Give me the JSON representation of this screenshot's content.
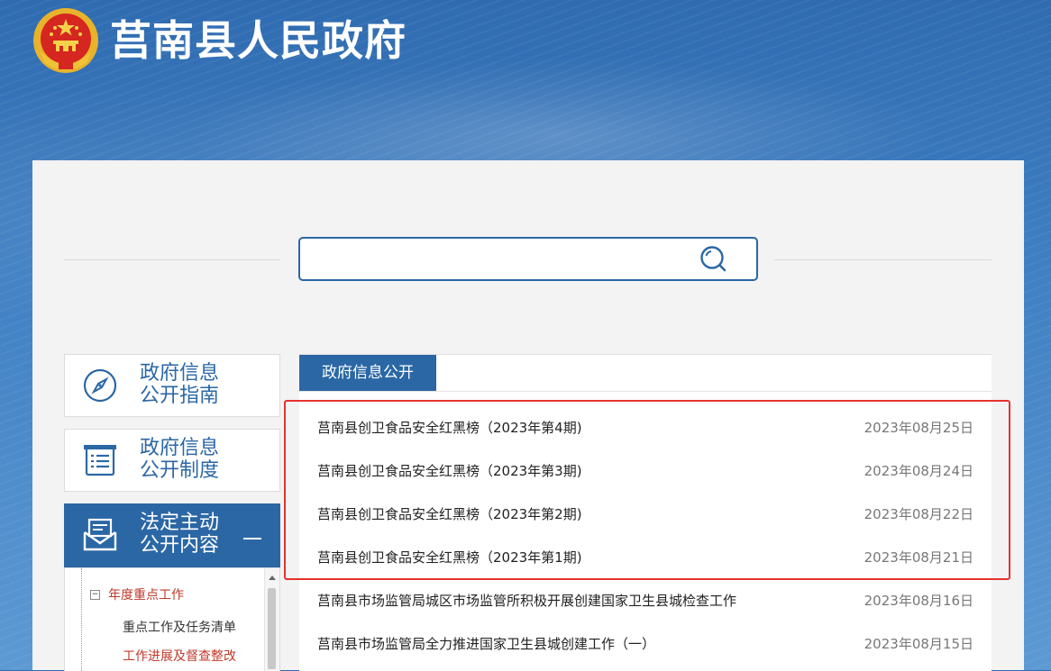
{
  "site": {
    "title": "莒南县人民政府"
  },
  "search": {
    "value": "",
    "placeholder": ""
  },
  "sidebar": {
    "cards": [
      {
        "line1": "政府信息",
        "line2": "公开指南",
        "icon": "compass-icon"
      },
      {
        "line1": "政府信息",
        "line2": "公开制度",
        "icon": "document-list-icon"
      },
      {
        "line1": "法定主动",
        "line2": "公开内容",
        "icon": "envelope-icon",
        "active": true
      }
    ],
    "tree": {
      "group": "年度重点工作",
      "items": [
        {
          "label": "重点工作及任务清单"
        },
        {
          "label": "工作进展及督查整改"
        }
      ]
    }
  },
  "main": {
    "tab": "政府信息公开",
    "items": [
      {
        "title": "莒南县创卫食品安全红黑榜（2023年第4期)",
        "date": "2023年08月25日"
      },
      {
        "title": "莒南县创卫食品安全红黑榜（2023年第3期)",
        "date": "2023年08月24日"
      },
      {
        "title": "莒南县创卫食品安全红黑榜（2023年第2期)",
        "date": "2023年08月22日"
      },
      {
        "title": "莒南县创卫食品安全红黑榜（2023年第1期)",
        "date": "2023年08月21日"
      },
      {
        "title": "莒南县市场监管局城区市场监管所积极开展创建国家卫生县城检查工作",
        "date": "2023年08月16日"
      },
      {
        "title": "莒南县市场监管局全力推进国家卫生县城创建工作（一）",
        "date": "2023年08月15日"
      }
    ]
  },
  "colors": {
    "brand_blue": "#2b67a5",
    "highlight_red": "#e6322d",
    "tree_active_red": "#c0392b"
  }
}
